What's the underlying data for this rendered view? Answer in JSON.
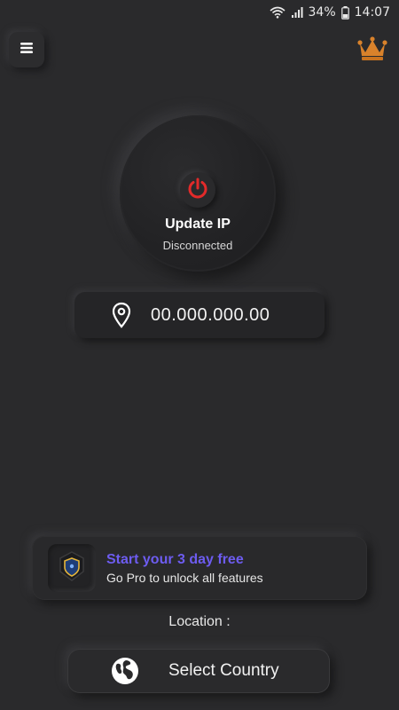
{
  "status_bar": {
    "battery_percent": "34%",
    "time": "14:07",
    "wifi_icon": "wifi-icon",
    "signal_icon": "signal-icon",
    "battery_icon": "battery-icon"
  },
  "header": {
    "menu_icon": "hamburger-menu-icon",
    "premium_icon": "crown-icon"
  },
  "connect": {
    "power_icon": "power-icon",
    "title": "Update IP",
    "status": "Disconnected"
  },
  "ip": {
    "pin_icon": "location-pin-icon",
    "value": "00.000.000.00"
  },
  "pro_banner": {
    "shield_icon": "shield-icon",
    "title": "Start your 3 day free",
    "subtitle": "Go Pro to unlock all features"
  },
  "location": {
    "label": "Location :",
    "globe_icon": "globe-icon",
    "select_label": "Select Country"
  },
  "colors": {
    "background": "#2a2a2c",
    "power_red": "#e22a2a",
    "crown_orange": "#d9822b",
    "pro_purple": "#6d5cf0"
  }
}
